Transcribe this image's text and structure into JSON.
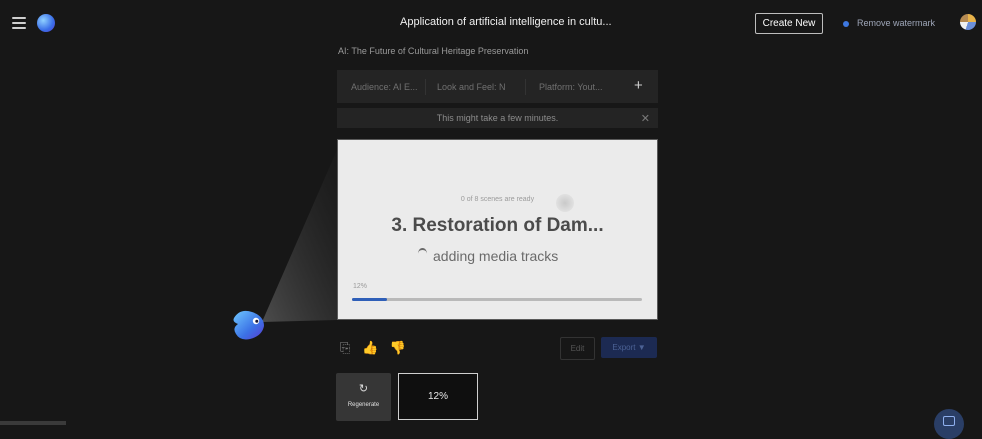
{
  "header": {
    "menu_icon": "hamburger-menu-icon",
    "logo_icon": "app-logo-icon",
    "title": "Application of artificial intelligence in cultu...",
    "create_new_label": "Create New",
    "remove_watermark_label": "Remove watermark",
    "avatar_icon": "user-avatar-icon"
  },
  "video_title": "AI: The Future of Cultural Heritage Preservation",
  "options": {
    "audience": "Audience: AI E...",
    "look_and_feel": "Look and Feel: N",
    "platform": "Platform: Yout...",
    "add_icon": "+"
  },
  "notice": {
    "text": "This might take a few minutes.",
    "close_icon": "✕"
  },
  "preview": {
    "scenes_ready": "0 of 8 scenes are ready",
    "scene_title": "3. Restoration of Dam...",
    "status": "adding media tracks",
    "progress_label": "12%",
    "progress_value": 0.12
  },
  "feedback": {
    "copy_icon": "⎘",
    "like_icon": "👍",
    "dislike_icon": "👎"
  },
  "actions": {
    "edit_label": "Edit",
    "export_label": "Export ▼"
  },
  "regenerate": {
    "icon": "↻",
    "label": "Regenerate"
  },
  "thumbnail": {
    "percent": "12%"
  },
  "colors": {
    "background": "#171717",
    "accent": "#2f5fb8",
    "export_bg": "#1c2a52"
  }
}
